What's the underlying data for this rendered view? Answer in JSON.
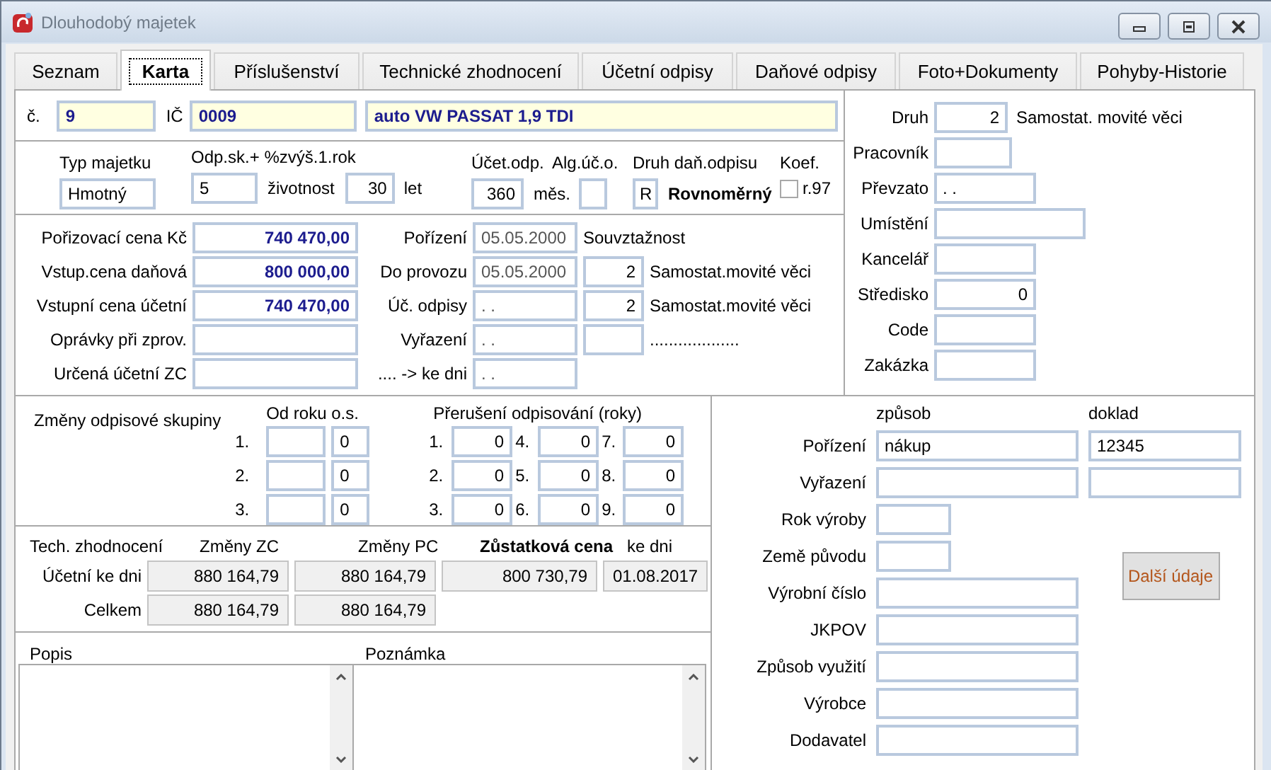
{
  "window": {
    "title": "Dlouhodobý majetek"
  },
  "tabs": [
    {
      "label": "Seznam",
      "selected": false
    },
    {
      "label": "Karta",
      "selected": true
    },
    {
      "label": "Příslušenství",
      "selected": false
    },
    {
      "label": "Technické zhodnocení",
      "selected": false
    },
    {
      "label": "Účetní odpisy",
      "selected": false
    },
    {
      "label": "Daňové odpisy",
      "selected": false
    },
    {
      "label": "Foto+Dokumenty",
      "selected": false
    },
    {
      "label": "Pohyby-Historie",
      "selected": false
    }
  ],
  "header": {
    "number_label": "č.",
    "number": "9",
    "id_label": "IČ",
    "id": "0009",
    "name": "auto VW PASSAT 1,9 TDI"
  },
  "classification": {
    "type_label": "Typ majetku",
    "type": "Hmotný",
    "group_label": "Odp.sk.+ %zvýš.1.rok",
    "group": "5",
    "life_label": "životnost",
    "life": "30",
    "life_unit": "let",
    "acc_label": "Účet.odp.",
    "acc_months": "360",
    "acc_unit": "měs.",
    "alg_label": "Alg.úč.o.",
    "tax_label": "Druh daň.odpisu",
    "tax_code": "R",
    "tax_method": "Rovnoměrný",
    "koef_label": "Koef.",
    "koef_checkbox": {
      "label": "r.97",
      "checked": false
    }
  },
  "value_rows": [
    {
      "price_label": "Pořizovací cena Kč",
      "price": "740 470,00",
      "date_label": "Pořízení",
      "date": "05.05.2000",
      "relation_label": "Souvztažnost"
    },
    {
      "price_label": "Vstup.cena daňová",
      "price": "800 000,00",
      "date_label": "Do provozu",
      "date": "05.05.2000",
      "relation_code": "2",
      "relation_text": "Samostat.movité věci"
    },
    {
      "price_label": "Vstupní cena účetní",
      "price": "740 470,00",
      "date_label": "Úč. odpisy",
      "date": ". .",
      "relation_code": "2",
      "relation_text": "Samostat.movité věci"
    },
    {
      "price_label": "Oprávky při zprov.",
      "date_label": "Vyřazení",
      "date": ". .",
      "relation_text": "..................."
    },
    {
      "price_label": "Určená účetní ZC",
      "date_label": ".... -> ke dni",
      "date": ". ."
    }
  ],
  "details": [
    {
      "label": "Druh",
      "value": "2",
      "note": "Samostat. movité věci"
    },
    {
      "label": "Pracovník"
    },
    {
      "label": "Převzato",
      "value": ". ."
    },
    {
      "label": "Umístění"
    },
    {
      "label": "Kancelář"
    },
    {
      "label": "Středisko",
      "value": "0"
    },
    {
      "label": "Code"
    },
    {
      "label": "Zakázka"
    }
  ],
  "group_changes": {
    "title": "Změny odpisové skupiny",
    "col_year": "Od roku",
    "col_group": "o.s.",
    "rows": [
      {
        "num": "1.",
        "group": "0"
      },
      {
        "num": "2.",
        "group": "0"
      },
      {
        "num": "3.",
        "group": "0"
      }
    ]
  },
  "interruptions": {
    "title": "Přerušení odpisování (roky)",
    "cells": [
      {
        "num": "1.",
        "value": "0"
      },
      {
        "num": "2.",
        "value": "0"
      },
      {
        "num": "3.",
        "value": "0"
      },
      {
        "num": "4.",
        "value": "0"
      },
      {
        "num": "5.",
        "value": "0"
      },
      {
        "num": "6.",
        "value": "0"
      },
      {
        "num": "7.",
        "value": "0"
      },
      {
        "num": "8.",
        "value": "0"
      },
      {
        "num": "9.",
        "value": "0"
      }
    ]
  },
  "tech": {
    "title": "Tech. zhodnocení",
    "col_zc": "Změny ZC",
    "col_pc": "Změny PC",
    "col_residual": "Zůstatková cena",
    "col_date": "ke dni",
    "rows": [
      {
        "label": "Účetní ke dni",
        "zc": "880 164,79",
        "pc": "880 164,79",
        "residual": "800 730,79",
        "date": "01.08.2017"
      },
      {
        "label": "Celkem",
        "zc": "880 164,79",
        "pc": "880 164,79"
      }
    ]
  },
  "notes": [
    {
      "label": "Popis"
    },
    {
      "label": "Poznámka"
    }
  ],
  "origin": {
    "col_method": "způsob",
    "col_doc": "doklad",
    "rows": [
      {
        "label": "Pořízení",
        "method": "nákup",
        "doc": "12345"
      },
      {
        "label": "Vyřazení"
      }
    ],
    "fields": [
      {
        "label": "Rok výroby"
      },
      {
        "label": "Země původu"
      },
      {
        "label": "Výrobní číslo"
      },
      {
        "label": "JKPOV"
      },
      {
        "label": "Způsob využití"
      },
      {
        "label": "Výrobce"
      },
      {
        "label": "Dodavatel"
      }
    ],
    "button": "Další údaje"
  }
}
